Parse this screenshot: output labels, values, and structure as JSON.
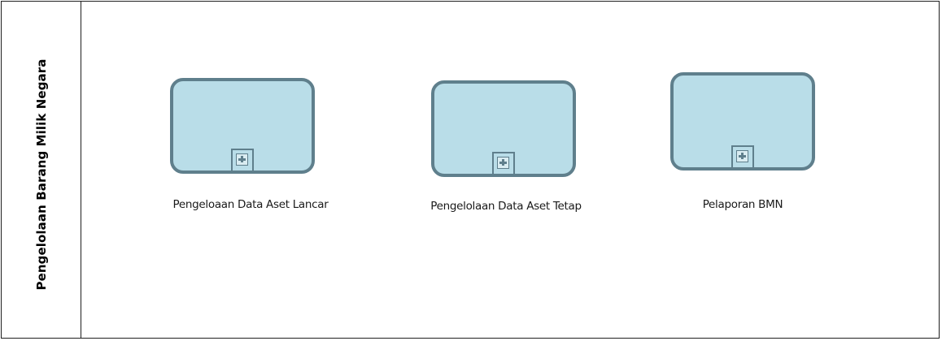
{
  "lane": {
    "title": "Pengelolaan Barang Milik Negara"
  },
  "tasks": [
    {
      "label": "Pengeloaan Data Aset Lancar",
      "marker": "plus-icon"
    },
    {
      "label": "Pengelolaan Data Aset Tetap",
      "marker": "plus-icon"
    },
    {
      "label": "Pelaporan BMN",
      "marker": "plus-icon"
    }
  ],
  "colors": {
    "task_fill": "#b9dde8",
    "task_border": "#5f7f8c",
    "pool_border": "#1f1f1f",
    "text": "#000000"
  }
}
